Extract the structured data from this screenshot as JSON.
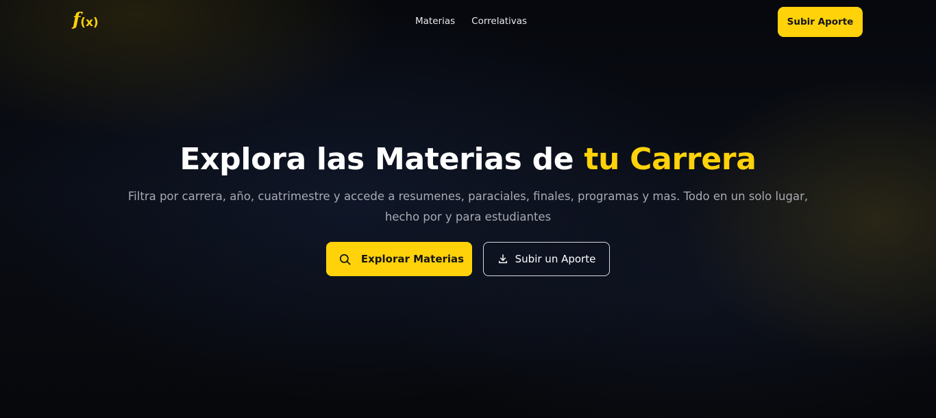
{
  "header": {
    "logo": {
      "f": "f",
      "x": "(x)"
    },
    "nav": [
      {
        "label": "Materias"
      },
      {
        "label": "Correlativas"
      }
    ],
    "cta_label": "Subir Aporte"
  },
  "hero": {
    "title_prefix": "Explora las Materias de ",
    "title_accent": "tu Carrera",
    "subtitle": "Filtra por carrera, año, cuatrimestre y accede a resumenes, paraciales, finales, programas y mas. Todo en un solo lugar, hecho por y para estudiantes",
    "primary_button": {
      "label": "Explorar Materias",
      "icon": "search-icon"
    },
    "secondary_button": {
      "label": "Subir un Aporte",
      "icon": "download-icon"
    }
  },
  "colors": {
    "accent": "#ffd20a",
    "background": "#07080b",
    "text_muted": "#a9abb3"
  }
}
